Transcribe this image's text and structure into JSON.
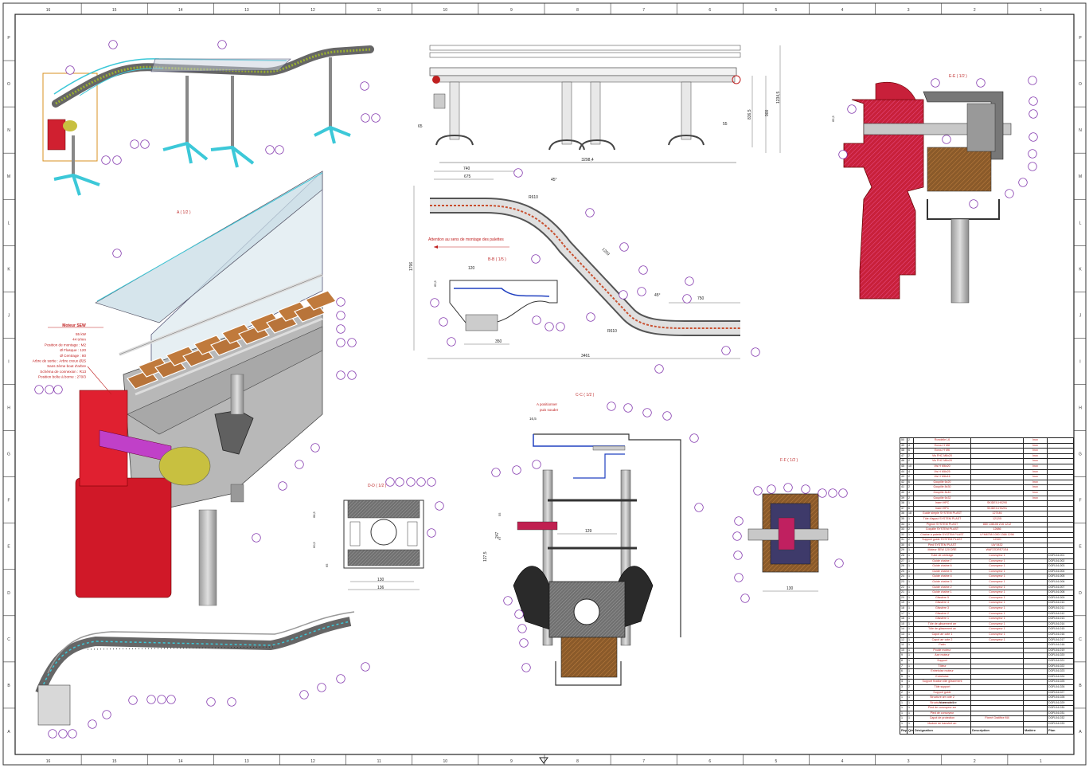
{
  "frame": {
    "columns": [
      "16",
      "15",
      "14",
      "13",
      "12",
      "11",
      "10",
      "9",
      "8",
      "7",
      "6",
      "5",
      "4",
      "3",
      "2",
      "1"
    ],
    "rows": [
      "P",
      "O",
      "N",
      "M",
      "L",
      "K",
      "J",
      "I",
      "H",
      "G",
      "F",
      "E",
      "D",
      "C",
      "B",
      "A"
    ]
  },
  "views": {
    "section_a": "A ( 1/2 )",
    "section_bb": "B-B ( 1/5 )",
    "section_cc": "C-C ( 1/2 )",
    "section_dd": "D-D ( 1/2 )",
    "section_ee": "E-E ( 1/2 )",
    "section_ff": "F-F ( 1/2 )",
    "detail_a": "A"
  },
  "motor": {
    "title": "Moteur SEW",
    "lines": [
      "55 kW",
      "44 tr/mn",
      "Position de montage : M2",
      "Ø Flasque : 120",
      "Ø Centrage : 80",
      "Arbre de sortie : Arbre creux Ø25",
      "Sans 2ème bout d'arbre",
      "Schéma de connexion : R13",
      "Position boîte à borne : 270/3"
    ]
  },
  "notes": {
    "mounting": "Attention au sens de montage des palettes",
    "a_positionner": "A positionner",
    "puis_souder": "puis souder"
  },
  "dims": {
    "d740": "740",
    "d675": "675",
    "d1796": "1796",
    "dR610a": "R610",
    "dR610b": "R610",
    "d750": "750",
    "d3461": "3461",
    "d45a": "45°",
    "d45b": "45°",
    "d1250": "1250",
    "d350": "350",
    "d3298": "3298,4",
    "d65": "65",
    "d55": "55",
    "d836": "836,5",
    "d900": "900",
    "d1234": "1234,5",
    "dd130": "130",
    "dd136": "136",
    "dd60": "60,5",
    "dd68": "68,5",
    "dd65": "65",
    "cc16": "16,5",
    "cc129": "129",
    "cc247": "247",
    "cc127": "127,5",
    "cc55": "55",
    "cc67": "67",
    "ee65": "65,5",
    "ff130": "130",
    "bb120": "120",
    "bb65": "65,5"
  },
  "bom": {
    "headers": [
      "Rep",
      "Qté",
      "Désignation",
      "Description",
      "Matière",
      "Plan"
    ],
    "rows": [
      [
        "50",
        "2",
        "Rondelle L6",
        "",
        "Inox",
        ""
      ],
      [
        "49",
        "4",
        "Ecrou H M8",
        "",
        "Inox",
        ""
      ],
      [
        "48",
        "6",
        "Ecrou H M6",
        "",
        "Inox",
        ""
      ],
      [
        "47",
        "2",
        "Vis FHC M8x20",
        "",
        "Inox",
        ""
      ],
      [
        "46",
        "2",
        "Vis FHC M6x20",
        "",
        "Inox",
        ""
      ],
      [
        "45",
        "10",
        "Vis H M6x20",
        "",
        "Inox",
        ""
      ],
      [
        "44",
        "4",
        "Vis H M8x25",
        "",
        "Inox",
        ""
      ],
      [
        "43",
        "2",
        "Vis H M8x16",
        "",
        "Inox",
        ""
      ],
      [
        "42",
        "6",
        "Goupille 6x20",
        "",
        "Inox",
        ""
      ],
      [
        "41",
        "2",
        "Goupille 8x30",
        "",
        "Inox",
        ""
      ],
      [
        "40",
        "4",
        "Goupille 8x40",
        "",
        "Inox",
        ""
      ],
      [
        "39",
        "2",
        "Goupille 6x32",
        "",
        "Inox",
        ""
      ],
      [
        "38",
        "1",
        "Insert HPC",
        "SKIDEX-H0290",
        "",
        ""
      ],
      [
        "37",
        "6",
        "Insert HPC",
        "SKIDEX-H0291",
        "",
        ""
      ],
      [
        "36",
        "18",
        "Guide simple SYSTEM PLAST",
        "127446",
        "",
        ""
      ],
      [
        "35",
        "1",
        "Tôle d'appui SYSTEM PLAST",
        "1212/5",
        "",
        ""
      ],
      [
        "34",
        "1",
        "Pignon SYSTEM PLAST",
        "880 138108 Z16 1212",
        "",
        ""
      ],
      [
        "33",
        "2",
        "Coquille SYSTEM PLAST",
        "12686",
        "",
        ""
      ],
      [
        "32",
        "1",
        "Chaîne à palette SYSTEM PLAST",
        "LFM8758 1050 1368 1298",
        "",
        ""
      ],
      [
        "31",
        "2",
        "Support guide SYSTEM PLAST",
        "12320",
        "",
        ""
      ],
      [
        "30",
        "4",
        "Pied SYSTEM PLAST",
        "LW 5432",
        "",
        ""
      ],
      [
        "29",
        "1",
        "Moteur SEW 120 DRE",
        "WAF37DRE71S4",
        "",
        ""
      ],
      [
        "28",
        "1",
        "Tube de centrage",
        "Convoyeur 1",
        "",
        "DOR-04-001"
      ],
      [
        "27",
        "1",
        "Guide chaîne 7",
        "Convoyeur 1",
        "",
        "DOR-04-002"
      ],
      [
        "26",
        "1",
        "Guide chaîne 6",
        "Convoyeur 1",
        "",
        "DOR-04-003"
      ],
      [
        "25",
        "1",
        "Guide chaîne 5",
        "Convoyeur 1",
        "",
        "DOR-04-004"
      ],
      [
        "24",
        "1",
        "Guide chaîne 4",
        "Convoyeur 1",
        "",
        "DOR-04-005"
      ],
      [
        "23",
        "1",
        "Guide chaîne 3",
        "Convoyeur 1",
        "",
        "DOR-04-006"
      ],
      [
        "22",
        "1",
        "Guide chaîne 2",
        "Convoyeur 1",
        "",
        "DOR-04-007"
      ],
      [
        "21",
        "1",
        "Guide chaîne 1",
        "Convoyeur 1",
        "",
        "DOR-04-008"
      ],
      [
        "20",
        "1",
        "Glissière 5",
        "Convoyeur 1",
        "",
        "DOR-04-009"
      ],
      [
        "19",
        "1",
        "Glissière 4",
        "Convoyeur 1",
        "",
        "DOR-04-010"
      ],
      [
        "18",
        "1",
        "Glissière 3",
        "Convoyeur 1",
        "",
        "DOR-04-011"
      ],
      [
        "17",
        "1",
        "Glissière 2",
        "Convoyeur 1",
        "",
        "DOR-04-012"
      ],
      [
        "16",
        "1",
        "Glissière 1",
        "Convoyeur 1",
        "",
        "DOR-04-013"
      ],
      [
        "15",
        "1",
        "Tôle de glissement arr",
        "Convoyeur 1",
        "",
        "DOR-04-014"
      ],
      [
        "14",
        "1",
        "Tôle de glissement av",
        "Convoyeur 1",
        "",
        "DOR-04-015"
      ],
      [
        "13",
        "1",
        "Capot arr cote 1",
        "Convoyeur 1",
        "",
        "DOR-04-016"
      ],
      [
        "12",
        "1",
        "Capot arr cote 2",
        "Convoyeur 1",
        "",
        "DOR-04-017"
      ],
      [
        "11",
        "1",
        "Patin",
        "",
        "",
        "DOR-04-018"
      ],
      [
        "10",
        "1",
        "Poulie moteur",
        "",
        "",
        "DOR-04-019"
      ],
      [
        "9",
        "1",
        "Axe moteur",
        "",
        "",
        "DOR-04-020"
      ],
      [
        "8",
        "1",
        "Support",
        "",
        "",
        "DOR-04-021"
      ],
      [
        "7",
        "1",
        "Tôleur",
        "",
        "",
        "DOR-04-022"
      ],
      [
        "6",
        "1",
        "Entretoise moteur",
        "",
        "",
        "DOR-04-023"
      ],
      [
        "5",
        "1",
        "Entretoise",
        "",
        "",
        "DOR-04-024"
      ],
      [
        "4",
        "1",
        "Support fixation tôle glissement",
        "",
        "",
        "DOR-04-025"
      ],
      [
        "3",
        "2",
        "Tôle support",
        "",
        "",
        "DOR-04-026"
      ],
      [
        "2",
        "1",
        "Support guide",
        "",
        "",
        "DOR-04-027"
      ],
      [
        "1",
        "1",
        "Structure arr cote 2",
        "",
        "",
        "DOR-04-028"
      ],
      [
        "1",
        "1",
        "Structure arr cote 1",
        "",
        "",
        "DOR-04-029"
      ],
      [
        "1",
        "1",
        "Pied de convoyeur arr",
        "",
        "",
        "DOR-04-030"
      ],
      [
        "1",
        "1",
        "Pied de convoyeur",
        "",
        "",
        "DOR-04-031"
      ],
      [
        "1",
        "1",
        "Capot de protection",
        "Fixmé Gratifixe M4",
        "",
        "DOR-04-032"
      ],
      [
        "1",
        "1",
        "Module de transfert arr",
        "",
        "",
        "DOR-04-033"
      ]
    ],
    "note": "Nomenclature"
  }
}
